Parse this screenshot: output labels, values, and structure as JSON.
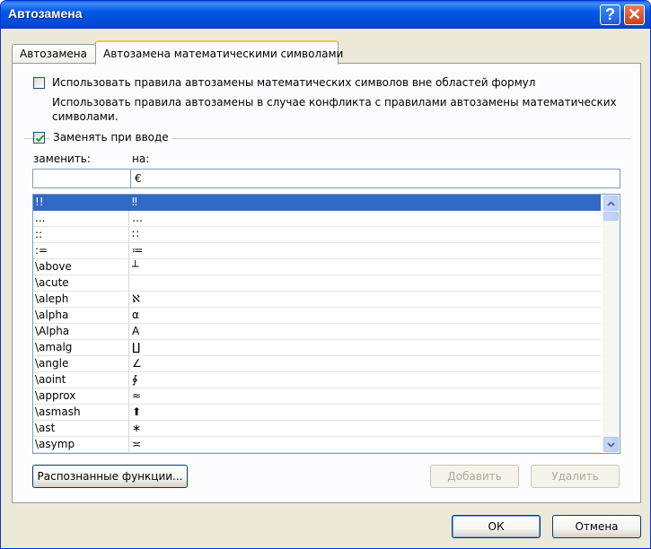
{
  "window": {
    "title": "Автозамена"
  },
  "title_buttons": {
    "help": "?",
    "close": "✕"
  },
  "tabs": [
    {
      "label": "Автозамена",
      "active": false
    },
    {
      "label": "Автозамена математическими символами",
      "active": true
    }
  ],
  "options": {
    "use_outside": {
      "label": "Использовать правила автозамены математических символов вне областей формул",
      "checked": false
    },
    "conflict_line1": "Использовать правила автозамены в случае конфликта с правилами автозамены математических",
    "conflict_line2": "символами.",
    "replace_as_you_type": {
      "label": "Заменять при вводе",
      "checked": true
    }
  },
  "columns": {
    "replace": "заменить:",
    "with": "на:"
  },
  "inputs": {
    "replace_value": "",
    "with_value": "€"
  },
  "entries": [
    {
      "key": "!!",
      "value": "‼",
      "selected": true
    },
    {
      "key": "...",
      "value": "…"
    },
    {
      "key": "::",
      "value": "∷"
    },
    {
      "key": ":=",
      "value": "≔"
    },
    {
      "key": "\\above",
      "value": "┴"
    },
    {
      "key": "\\acute",
      "value": ""
    },
    {
      "key": "\\aleph",
      "value": "ℵ"
    },
    {
      "key": "\\alpha",
      "value": "α"
    },
    {
      "key": "\\Alpha",
      "value": "A"
    },
    {
      "key": "\\amalg",
      "value": "∐"
    },
    {
      "key": "\\angle",
      "value": "∠"
    },
    {
      "key": "\\aoint",
      "value": "∳"
    },
    {
      "key": "\\approx",
      "value": "≈"
    },
    {
      "key": "\\asmash",
      "value": "⬆"
    },
    {
      "key": "\\ast",
      "value": "∗"
    },
    {
      "key": "\\asymp",
      "value": "≍"
    }
  ],
  "buttons": {
    "recognized": "Распознанные функции...",
    "add": "Добавить",
    "delete": "Удалить",
    "ok": "ОК",
    "cancel": "Отмена"
  },
  "colors": {
    "selection": "#316ac5",
    "title_bar": "#0058e6",
    "check": "#21a121"
  }
}
